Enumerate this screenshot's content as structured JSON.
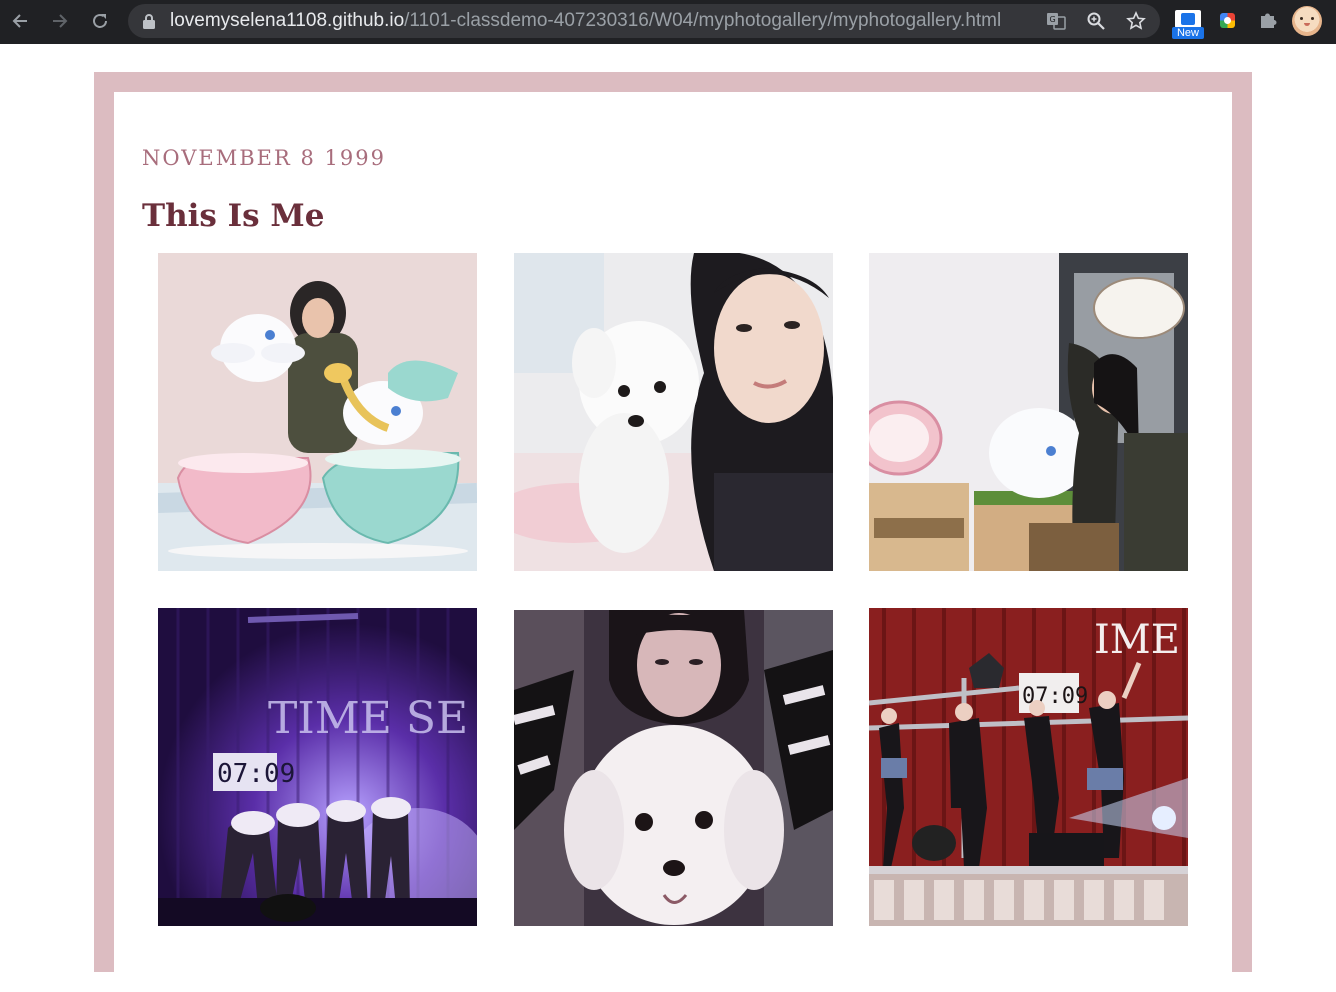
{
  "browser": {
    "url_host": "lovemyselena1108.github.io",
    "url_path": "/1101-classdemo-407230316/W04/myphotogallery/myphotogallery.html",
    "extension_badge": "New",
    "icons": [
      "back-arrow-icon",
      "forward-arrow-icon",
      "reload-icon",
      "lock-icon",
      "translate-icon",
      "zoom-icon",
      "star-icon",
      "extension-icon",
      "color-picker-icon",
      "puzzle-icon",
      "profile-avatar"
    ]
  },
  "page": {
    "date": "NOVEMBER 8 1999",
    "title": "This Is Me",
    "colors": {
      "frame": "#dcbcc1",
      "date": "#a86d7c",
      "title": "#6a2f3b"
    },
    "photos": [
      {
        "name": "photo-cinnamoroll-teacups"
      },
      {
        "name": "photo-selfie-with-white-dog"
      },
      {
        "name": "photo-amandier-cafe"
      },
      {
        "name": "photo-stage-dance-purple"
      },
      {
        "name": "photo-selfie-dog-closeup"
      },
      {
        "name": "photo-stage-performance-red"
      }
    ]
  }
}
